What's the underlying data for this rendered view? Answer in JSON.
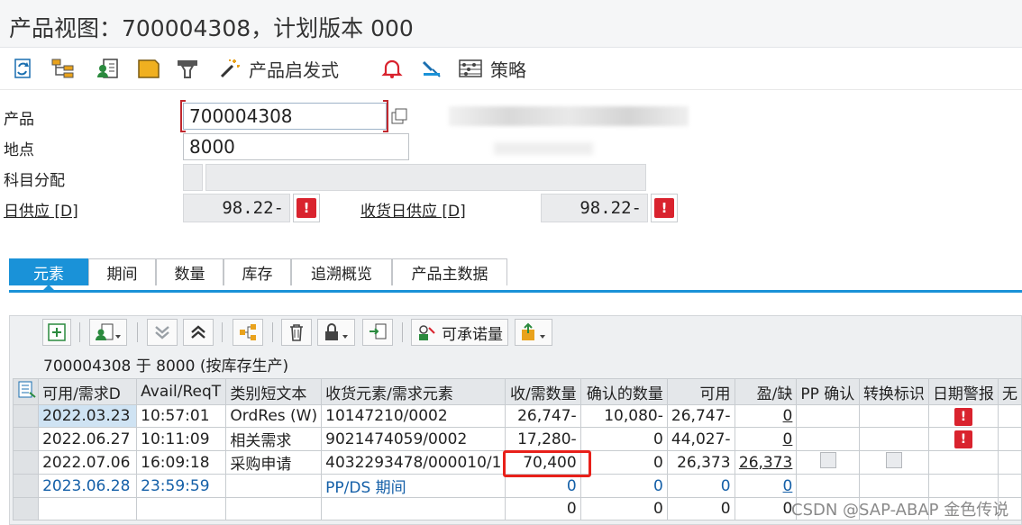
{
  "window": {
    "title": "产品视图：700004308，计划版本 000"
  },
  "toolbar": {
    "items": [
      {
        "icon": "refresh-icon"
      },
      {
        "icon": "hierarchy-icon"
      },
      {
        "icon": "user-list-icon"
      },
      {
        "icon": "folder-icon"
      },
      {
        "icon": "filter-icon"
      },
      {
        "icon": "magic-wand-icon",
        "label": "产品启发式"
      },
      {
        "icon": "alarm-bell-icon"
      },
      {
        "icon": "wrench-icon"
      },
      {
        "icon": "abacus-icon",
        "label": "策略"
      }
    ]
  },
  "header": {
    "product_label": "产品",
    "product_value": "700004308",
    "location_label": "地点",
    "location_value": "8000",
    "account_label": "科目分配",
    "days_supply_label": "日供应 [D]",
    "days_supply_value": "98.22-",
    "receipt_days_supply_label": "收货日供应 [D]",
    "receipt_days_supply_value": "98.22-",
    "alert_glyph": "!"
  },
  "tabs": [
    {
      "label": "元素",
      "active": true
    },
    {
      "label": "期间"
    },
    {
      "label": "数量"
    },
    {
      "label": "库存"
    },
    {
      "label": "追溯概览"
    },
    {
      "label": "产品主数据"
    }
  ],
  "grid_toolbar": {
    "buttons": [
      {
        "icon": "add-row-icon"
      },
      {
        "icon": "user-detail-icon"
      },
      {
        "icon": "expand-down-icon"
      },
      {
        "icon": "collapse-up-icon"
      },
      {
        "icon": "network-icon"
      },
      {
        "icon": "delete-icon"
      },
      {
        "icon": "lock-icon"
      },
      {
        "icon": "transfer-icon"
      },
      {
        "icon": "atp-icon",
        "label": "可承诺量"
      },
      {
        "icon": "export-icon"
      }
    ]
  },
  "grid": {
    "caption": "700004308 于 8000 (按库存生产)",
    "columns": [
      "可用/需求D",
      "Avail/ReqT",
      "类别短文本",
      "收货元素/需求元素",
      "收/需数量",
      "确认的数量",
      "可用",
      "盈/缺",
      "PP 确认",
      "转换标识",
      "日期警报",
      "无"
    ],
    "rows": [
      {
        "date": "2022.03.23",
        "time": "10:57:01",
        "category": "OrdRes (W)",
        "element": "10147210/0002",
        "qty": "26,747-",
        "confirmed": "10,080-",
        "available": "26,747-",
        "surplus": "0",
        "pp_check": false,
        "conv_check": false,
        "alert": true
      },
      {
        "date": "2022.06.27",
        "time": "10:11:09",
        "category": "相关需求",
        "element": "9021474059/0002",
        "qty": "17,280-",
        "confirmed": "0",
        "available": "44,027-",
        "surplus": "0",
        "pp_check": false,
        "conv_check": false,
        "alert": true
      },
      {
        "date": "2022.07.06",
        "time": "16:09:18",
        "category": "采购申请",
        "element": "4032293478/000010/1",
        "qty": "70,400",
        "confirmed": "0",
        "available": "26,373",
        "surplus": "26,373",
        "pp_check": true,
        "conv_check": true,
        "alert": false
      },
      {
        "date": "2023.06.28",
        "time": "23:59:59",
        "category": "",
        "element": "PP/DS 期间",
        "qty": "0",
        "confirmed": "0",
        "available": "0",
        "surplus": "0",
        "pp_check": false,
        "conv_check": false,
        "alert": false
      },
      {
        "date": "",
        "time": "",
        "category": "",
        "element": "",
        "qty": "0",
        "confirmed": "0",
        "available": "0",
        "surplus": "0",
        "pp_check": false,
        "conv_check": false,
        "alert": false
      }
    ]
  },
  "watermark": "CSDN @SAP-ABAP 金色传说",
  "colors": {
    "accent": "#1a92d8",
    "alert": "#d9232e",
    "highlight_box": "#e8201a",
    "link_blue": "#1560a8"
  }
}
